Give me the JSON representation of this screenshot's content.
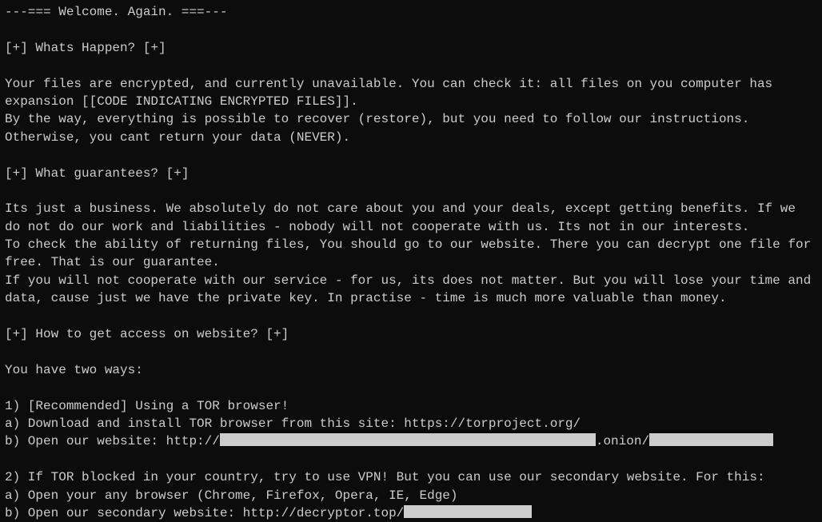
{
  "header": "---=== Welcome. Again. ===---",
  "sections": {
    "s1_title": "[+] Whats Happen? [+]",
    "s1_body": "Your files are encrypted, and currently unavailable. You can check it: all files on you computer has expansion [[CODE INDICATING ENCRYPTED FILES]].\nBy the way, everything is possible to recover (restore), but you need to follow our instructions. Otherwise, you cant return your data (NEVER).",
    "s2_title": "[+] What guarantees? [+]",
    "s2_body": "Its just a business. We absolutely do not care about you and your deals, except getting benefits. If we do not do our work and liabilities - nobody will not cooperate with us. Its not in our interests.\nTo check the ability of returning files, You should go to our website. There you can decrypt one file for free. That is our guarantee.\nIf you will not cooperate with our service - for us, its does not matter. But you will lose your time and data, cause just we have the private key. In practise - time is much more valuable than money.",
    "s3_title": "[+] How to get access on website? [+]",
    "s3_intro": "You have two ways:",
    "s3_way1_title": "1) [Recommended] Using a TOR browser!",
    "s3_way1_a": "a) Download and install TOR browser from this site: https://torproject.org/",
    "s3_way1_b_prefix": "b) Open our website: http://",
    "s3_way1_b_mid": ".onion/",
    "s3_way2_title": "2) If TOR blocked in your country, try to use VPN! But you can use our secondary website. For this:",
    "s3_way2_a": "a) Open your any browser (Chrome, Firefox, Opera, IE, Edge)",
    "s3_way2_b_prefix": "b) Open our secondary website: http://decryptor.top/"
  }
}
